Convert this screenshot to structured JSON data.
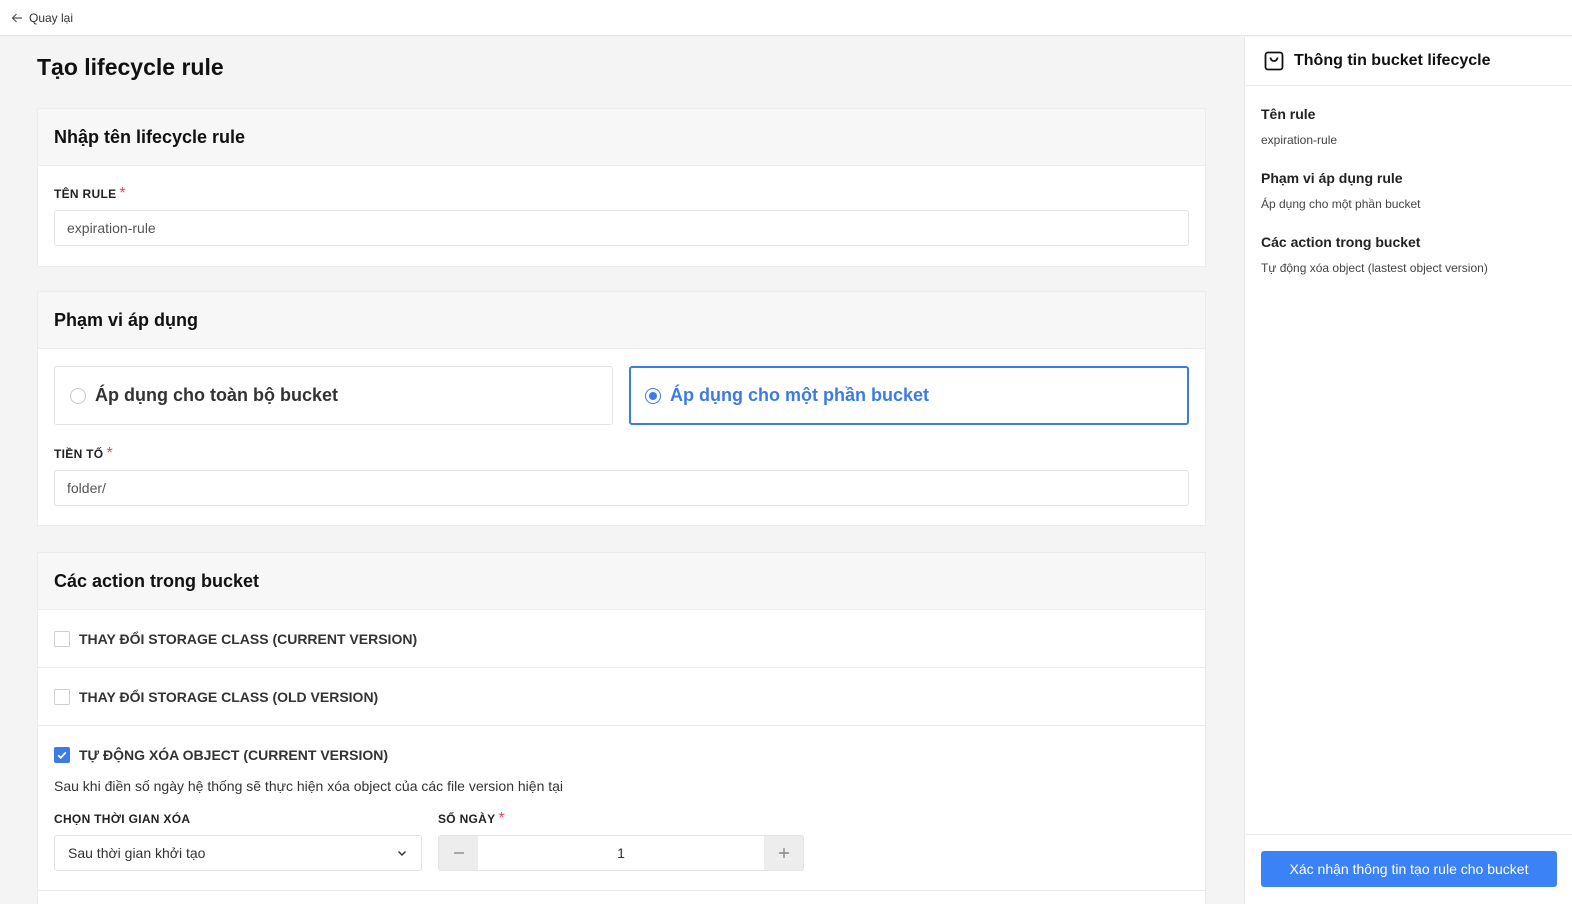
{
  "topbar": {
    "back_label": "Quay lại"
  },
  "page": {
    "title": "Tạo lifecycle rule"
  },
  "name_section": {
    "title": "Nhập tên lifecycle rule",
    "rule_name_label": "TÊN RULE",
    "rule_name_value": "expiration-rule"
  },
  "scope_section": {
    "title": "Phạm vi áp dụng",
    "option_all": "Áp dụng cho toàn bộ bucket",
    "option_partial": "Áp dụng cho một phần bucket",
    "selected": "partial",
    "prefix_label": "TIỀN TỐ",
    "prefix_value": "folder/"
  },
  "actions_section": {
    "title": "Các action trong bucket",
    "actions": [
      {
        "label": "THAY ĐỔI STORAGE CLASS (CURRENT VERSION)",
        "checked": false
      },
      {
        "label": "THAY ĐỔI STORAGE CLASS (OLD VERSION)",
        "checked": false
      },
      {
        "label": "TỰ ĐỘNG XÓA OBJECT (CURRENT VERSION)",
        "checked": true
      }
    ],
    "delete_description": "Sau khi điền số ngày hệ thống sẽ thực hiện xóa object của các file version hiện tại",
    "time_label": "CHỌN THỜI GIAN XÓA",
    "time_value": "Sau thời gian khởi tạo",
    "days_label": "SỐ NGÀY",
    "days_value": "1"
  },
  "sidebar": {
    "title": "Thông tin bucket lifecycle",
    "rule_name_title": "Tên rule",
    "rule_name_value": "expiration-rule",
    "scope_title": "Phạm vi áp dụng rule",
    "scope_value": "Áp dụng cho một phần bucket",
    "actions_title": "Các action trong bucket",
    "actions_value": "Tự động xóa object (lastest object version)",
    "confirm_button": "Xác nhận thông tin tạo rule cho bucket"
  },
  "colors": {
    "accent": "#3b7be8",
    "required": "#e5484d",
    "primary_button": "#3b82f6"
  },
  "icons": {
    "back": "arrow-left-icon",
    "sidebar": "shopping-bag-icon",
    "select": "chevron-down-icon",
    "minus": "minus-icon",
    "plus": "plus-icon",
    "check": "check-icon"
  }
}
